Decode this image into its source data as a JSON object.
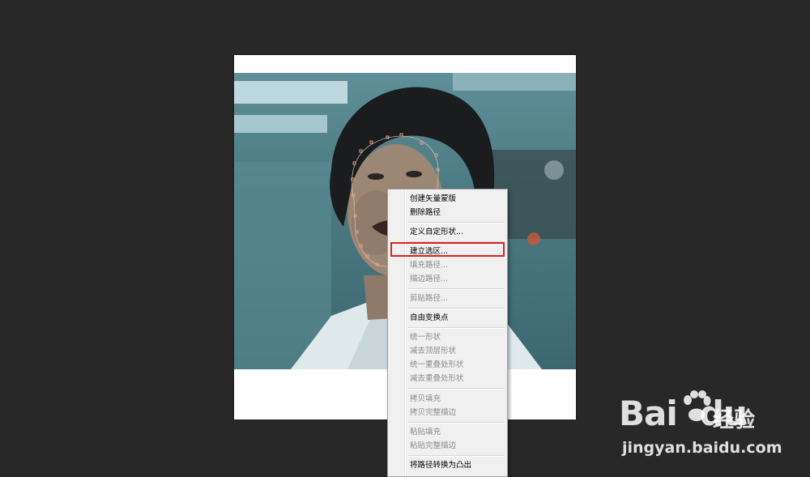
{
  "context_menu": {
    "items": [
      {
        "label": "创建矢量蒙版",
        "enabled": true
      },
      {
        "label": "删除路径",
        "enabled": true
      },
      {
        "label": "定义自定形状...",
        "enabled": true
      },
      {
        "label": "建立选区...",
        "enabled": true,
        "highlighted": true
      },
      {
        "label": "填充路径...",
        "enabled": false
      },
      {
        "label": "描边路径...",
        "enabled": false
      },
      {
        "label": "剪贴路径...",
        "enabled": false
      },
      {
        "label": "自由变换点",
        "enabled": true
      },
      {
        "label": "统一形状",
        "enabled": false
      },
      {
        "label": "减去顶层形状",
        "enabled": false
      },
      {
        "label": "统一重叠处形状",
        "enabled": false
      },
      {
        "label": "减去重叠处形状",
        "enabled": false
      },
      {
        "label": "拷贝填充",
        "enabled": false
      },
      {
        "label": "拷贝完整描边",
        "enabled": false
      },
      {
        "label": "粘贴填充",
        "enabled": false
      },
      {
        "label": "粘贴完整描边",
        "enabled": false
      },
      {
        "label": "将路径转换为凸出",
        "enabled": true
      }
    ]
  },
  "watermark": {
    "logo_text": "Bai",
    "logo_suffix": "du",
    "product": "经验",
    "url": "jingyan.baidu.com"
  },
  "colors": {
    "workspace_bg": "#282828",
    "highlight_border": "#e0221f",
    "path_anchor": "#e8a080"
  }
}
